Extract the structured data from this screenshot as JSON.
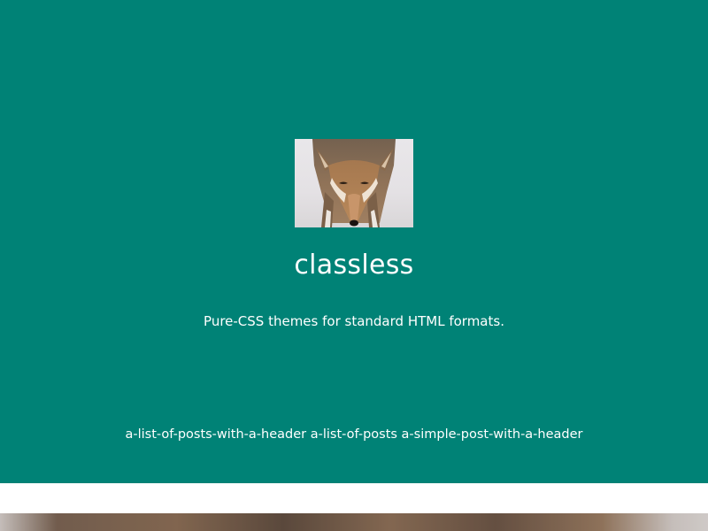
{
  "site": {
    "title": "classless",
    "tagline": "Pure-CSS themes for standard HTML formats."
  },
  "nav": {
    "items": [
      "a-list-of-posts-with-a-header",
      "a-list-of-posts",
      "a-simple-post-with-a-header"
    ]
  },
  "colors": {
    "header_background": "#008276",
    "text": "#ffffff",
    "page_background": "#ffffff"
  },
  "images": {
    "logo": "coyote-photo",
    "banner": "coyote-fur-banner"
  }
}
